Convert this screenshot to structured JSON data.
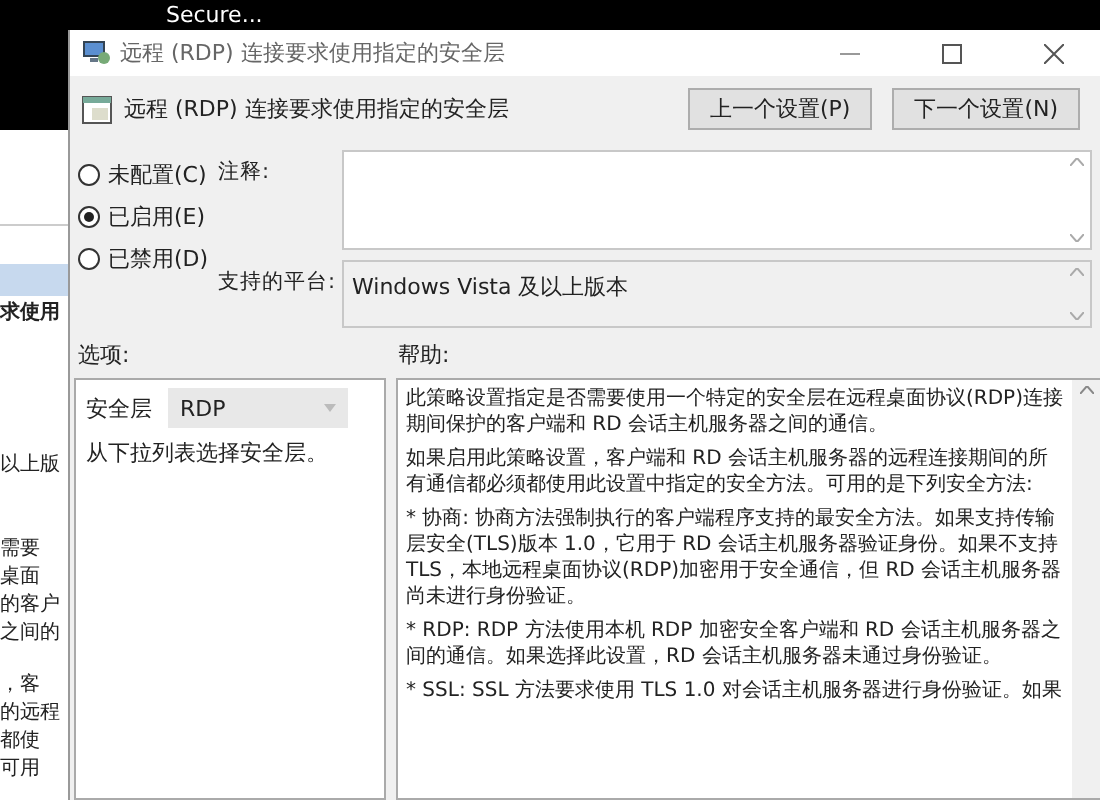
{
  "top_bar": {
    "title": "Secure..."
  },
  "background_window": {
    "texts": [
      {
        "text": "求使用",
        "kind": "bold"
      },
      {
        "text": "以上版",
        "kind": "plain"
      },
      {
        "text": "需要",
        "kind": "plain"
      },
      {
        "text": "桌面",
        "kind": "plain"
      },
      {
        "text": "的客户",
        "kind": "plain"
      },
      {
        "text": "之间的",
        "kind": "plain"
      },
      {
        "text": "，客",
        "kind": "plain"
      },
      {
        "text": "的远程",
        "kind": "plain"
      },
      {
        "text": "都使",
        "kind": "plain"
      },
      {
        "text": "可用",
        "kind": "plain"
      }
    ]
  },
  "dialog": {
    "title": "远程 (RDP) 连接要求使用指定的安全层",
    "header_title": "远程 (RDP) 连接要求使用指定的安全层",
    "buttons": [
      {
        "label": "上一个设置(P)"
      },
      {
        "label": "下一个设置(N)"
      }
    ],
    "radios": [
      {
        "label": "未配置(C)",
        "selected": false
      },
      {
        "label": "已启用(E)",
        "selected": true
      },
      {
        "label": "已禁用(D)",
        "selected": false
      }
    ],
    "comment": {
      "label": "注释:"
    },
    "platform": {
      "label": "支持的平台:",
      "value": "Windows Vista 及以上版本"
    },
    "options": {
      "label": "选项:",
      "security_layer": {
        "label": "安全层",
        "value": "RDP"
      },
      "hint": "从下拉列表选择安全层。"
    },
    "help": {
      "label": "帮助:",
      "paragraphs": [
        "此策略设置指定是否需要使用一个特定的安全层在远程桌面协议(RDP)连接期间保护的客户端和 RD 会话主机服务器之间的通信。",
        "如果启用此策略设置，客户端和 RD 会话主机服务器的远程连接期间的所有通信都必须都使用此设置中指定的安全方法。可用的是下列安全方法:",
        "* 协商: 协商方法强制执行的客户端程序支持的最安全方法。如果支持传输层安全(TLS)版本 1.0，它用于 RD 会话主机服务器验证身份。如果不支持 TLS，本地远程桌面协议(RDP)加密用于安全通信，但 RD 会话主机服务器尚未进行身份验证。",
        "* RDP: RDP 方法使用本机 RDP 加密安全客户端和 RD 会话主机服务器之间的通信。如果选择此设置，RD 会话主机服务器未通过身份验证。",
        "* SSL: SSL 方法要求使用 TLS 1.0 对会话主机服务器进行身份验证。如果"
      ]
    }
  }
}
